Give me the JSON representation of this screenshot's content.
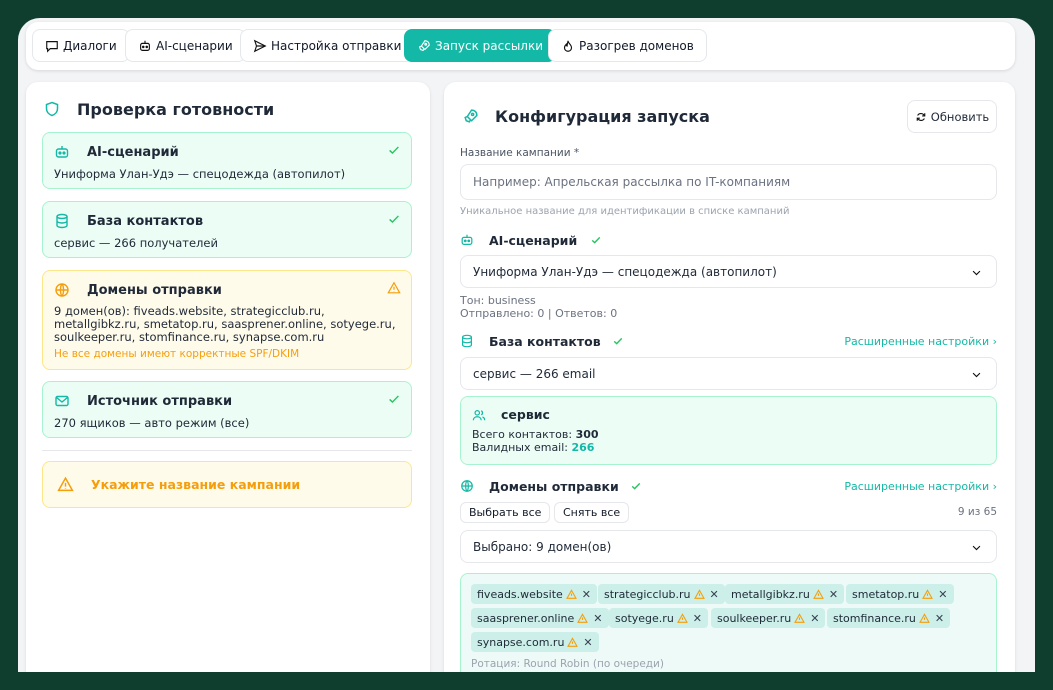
{
  "tabs": [
    {
      "label": "Диалоги"
    },
    {
      "label": "AI-сценарии"
    },
    {
      "label": "Настройка отправки"
    },
    {
      "label": "Запуск рассылки"
    },
    {
      "label": "Разогрев доменов"
    }
  ],
  "readiness": {
    "title": "Проверка готовности",
    "scenario": {
      "title": "AI-сценарий",
      "text": "Униформа Улан-Удэ — спецодежда (автопилот)"
    },
    "contacts": {
      "title": "База контактов",
      "text": "сервис — 266 получателей"
    },
    "domains": {
      "title": "Домены отправки",
      "line1": "9 домен(ов): fiveads.website, strategicclub.ru,",
      "line2": "metallgibkz.ru, smetatop.ru, saasprener.online, sotyege.ru,",
      "line3": "soulkeeper.ru, stomfinance.ru, synapse.com.ru",
      "note": "Не все домены имеют корректные SPF/DKIM"
    },
    "source": {
      "title": "Источник отправки",
      "text": "270 ящиков — авто режим (все)"
    },
    "warning": "Укажите название кампании"
  },
  "config": {
    "title": "Конфигурация запуска",
    "refresh": "Обновить",
    "campaign_label": "Название кампании *",
    "campaign_placeholder": "Например: Апрельская рассылка по IT-компаниям",
    "campaign_value": "",
    "campaign_help": "Уникальное название для идентификации в списке кампаний",
    "scenario_title": "AI-сценарий",
    "scenario_value": "Униформа Улан-Удэ — спецодежда (автопилот)",
    "tone": "Тон: business",
    "stats": "Отправлено: 0 | Ответов: 0",
    "contacts_title": "База контактов",
    "advanced": "Расширенные настройки",
    "contacts_value": "сервис — 266 email",
    "base_name": "сервис",
    "total_label": "Всего контактов: ",
    "total_value": "300",
    "valid_label": "Валидных email: ",
    "valid_value": "266",
    "domains_title": "Домены отправки",
    "select_all": "Выбрать все",
    "deselect_all": "Снять все",
    "count": "9 из 65",
    "domains_value": "Выбрано: 9 домен(ов)",
    "chips": [
      "fiveads.website",
      "strategicclub.ru",
      "metallgibkz.ru",
      "smetatop.ru",
      "saasprener.online",
      "sotyege.ru",
      "soulkeeper.ru",
      "stomfinance.ru",
      "synapse.com.ru"
    ],
    "rotation": "Ротация: Round Robin (по очереди)"
  },
  "colors": {
    "accent": "#14b8a6",
    "success_bg": "#ecfdf5",
    "warn_bg": "#fffbeb",
    "warn": "#f59e0b",
    "frame": "#0f3d2e"
  }
}
